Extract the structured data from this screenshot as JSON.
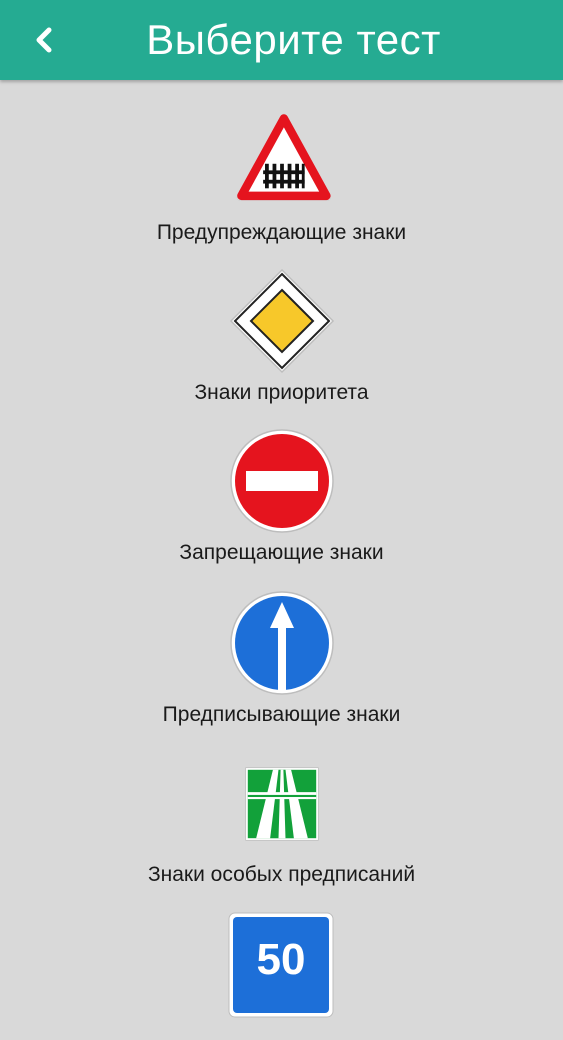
{
  "header": {
    "title": "Выберите тест",
    "back_icon": "chevron-left-icon",
    "color": "#25ab92"
  },
  "tests": [
    {
      "label": "Предупреждающие знаки",
      "icon": "warning-sign-railroad-crossing-icon"
    },
    {
      "label": "Знаки приоритета",
      "icon": "priority-road-sign-icon"
    },
    {
      "label": "Запрещающие знаки",
      "icon": "no-entry-sign-icon"
    },
    {
      "label": "Предписывающие знаки",
      "icon": "straight-ahead-sign-icon"
    },
    {
      "label": "Знаки особых предписаний",
      "icon": "motorway-sign-icon"
    },
    {
      "label": "50",
      "icon": "speed-sign-icon"
    }
  ]
}
